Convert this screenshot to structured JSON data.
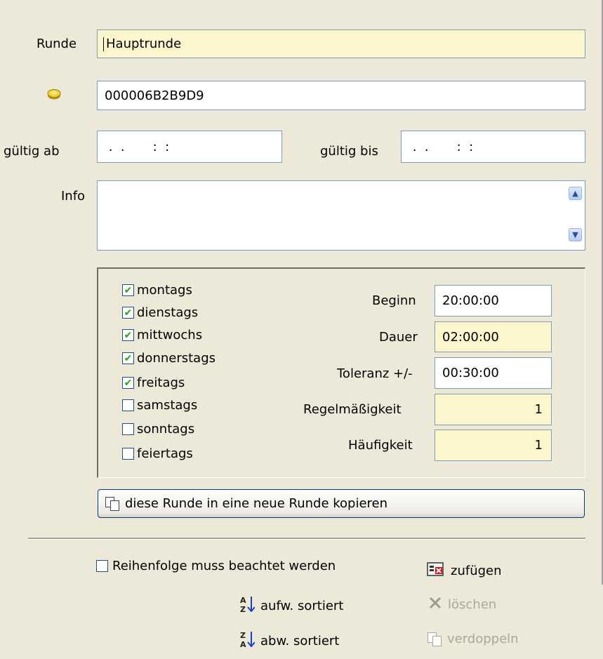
{
  "form": {
    "runde_label": "Runde",
    "runde_value": "Hauptrunde",
    "chip_value": "000006B2B9D9",
    "gueltig_ab_label": "gültig ab",
    "gueltig_ab_value": " .  .       :  :",
    "gueltig_bis_label": "gültig bis",
    "gueltig_bis_value": " .  .       :  :",
    "info_label": "Info",
    "info_value": ""
  },
  "schedule": {
    "days": [
      {
        "label": "montags",
        "checked": true
      },
      {
        "label": "dienstags",
        "checked": true
      },
      {
        "label": "mittwochs",
        "checked": true
      },
      {
        "label": "donnerstags",
        "checked": true
      },
      {
        "label": "freitags",
        "checked": true
      },
      {
        "label": "samstags",
        "checked": false
      },
      {
        "label": "sonntags",
        "checked": false
      },
      {
        "label": "feiertags",
        "checked": false
      }
    ],
    "beginn_label": "Beginn",
    "beginn_value": "20:00:00",
    "dauer_label": "Dauer",
    "dauer_value": "02:00:00",
    "toleranz_label": "Toleranz +/-",
    "toleranz_value": "00:30:00",
    "regel_label": "Regelmäßigkeit",
    "regel_value": "1",
    "haeuf_label": "Häufigkeit",
    "haeuf_value": "1"
  },
  "copy_button_label": "diese Runde in eine neue Runde kopieren",
  "bottom": {
    "order_checkbox_label": "Reihenfolge muss beachtet werden",
    "order_checked": false,
    "add_label": "zufügen",
    "sort_asc_label": "aufw. sortiert",
    "sort_desc_label": "abw. sortiert",
    "delete_label": "löschen",
    "duplicate_label": "verdoppeln"
  },
  "colors": {
    "background": "#ece9d8",
    "required_field": "#fdf6cd",
    "field_border": "#7f9db9",
    "check_green": "#21a121",
    "disabled_text": "#aca899"
  },
  "icons": {
    "chip": "yellow-chip-icon",
    "scroll_up": "scroll-up-icon",
    "scroll_down": "scroll-down-icon",
    "copy": "copy-icon",
    "add": "add-icon",
    "sort_asc": "sort-ascending-icon",
    "sort_desc": "sort-descending-icon",
    "delete": "delete-icon",
    "duplicate": "duplicate-icon"
  }
}
